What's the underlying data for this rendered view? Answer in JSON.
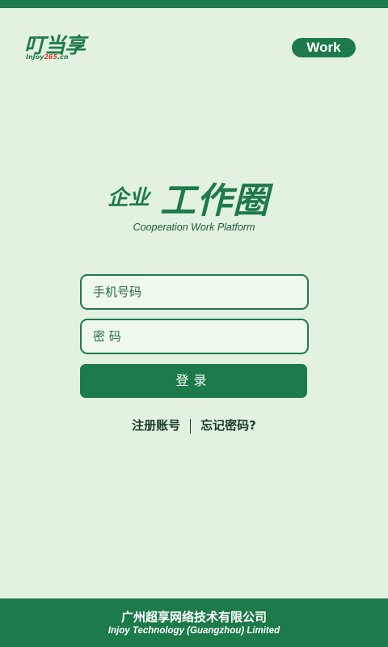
{
  "logo": {
    "main": "叮当享",
    "sub_prefix": "InJoy",
    "sub_highlight": "265",
    "sub_suffix": ".cn"
  },
  "badge": {
    "label": "Work"
  },
  "brand": {
    "small": "企业",
    "big": "工作圈",
    "english": "Cooperation Work Platform"
  },
  "form": {
    "phone_placeholder": "手机号码",
    "password_placeholder": "密 码",
    "login_label": "登录"
  },
  "links": {
    "register": "注册账号",
    "forgot": "忘记密码?"
  },
  "footer": {
    "company_cn": "广州超享网络技术有限公司",
    "company_en": "Injoy Technology (Guangzhou) Limited"
  },
  "colors": {
    "primary": "#1d7a4a",
    "background": "#e3f1e1",
    "logo_accent": "#d23a2a"
  }
}
